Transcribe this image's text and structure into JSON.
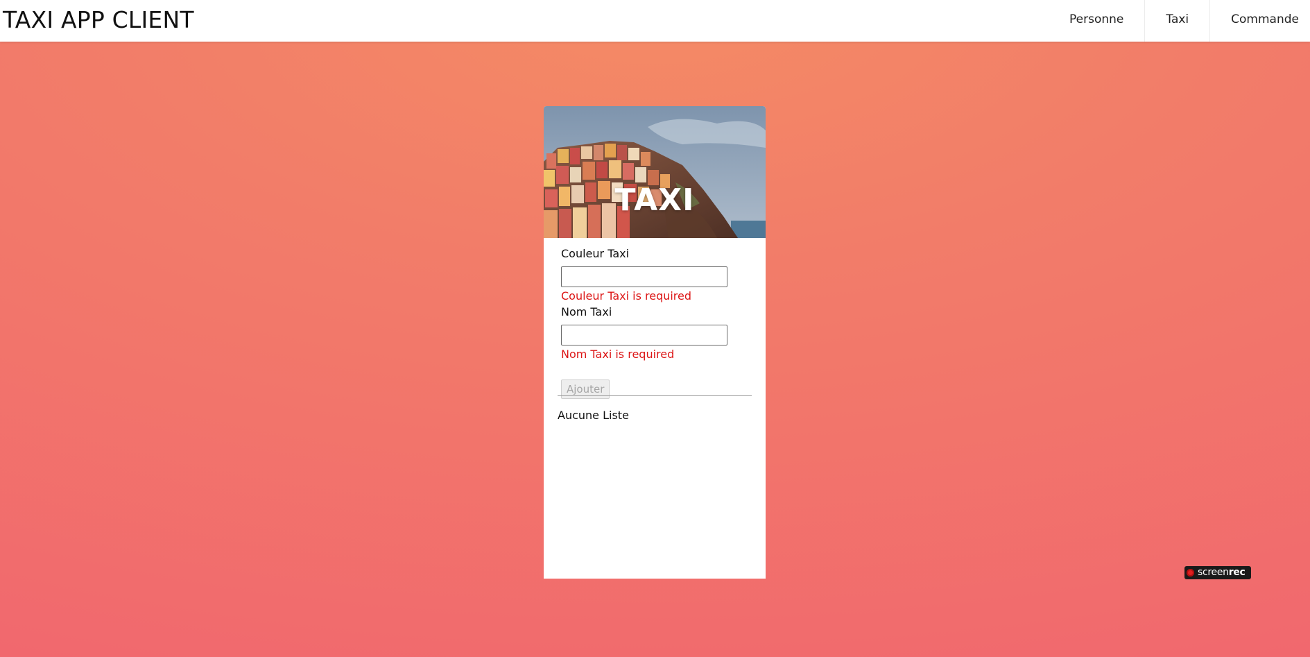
{
  "navbar": {
    "brand": "TAXI APP CLIENT",
    "links": [
      "Personne",
      "Taxi",
      "Commande"
    ]
  },
  "card": {
    "hero_title": "TAXI",
    "fields": [
      {
        "label": "Couleur Taxi",
        "value": "",
        "error": "Couleur Taxi is required"
      },
      {
        "label": "Nom Taxi",
        "value": "",
        "error": "Nom Taxi is required"
      }
    ],
    "submit_label": "Ajouter",
    "submit_disabled": true,
    "empty_list_text": "Aucune Liste"
  },
  "recorder": {
    "text_light": "screen",
    "text_bold": "rec"
  },
  "colors": {
    "error": "#dc1616",
    "background_top": "#f48b65",
    "background_bottom": "#f1686e"
  }
}
